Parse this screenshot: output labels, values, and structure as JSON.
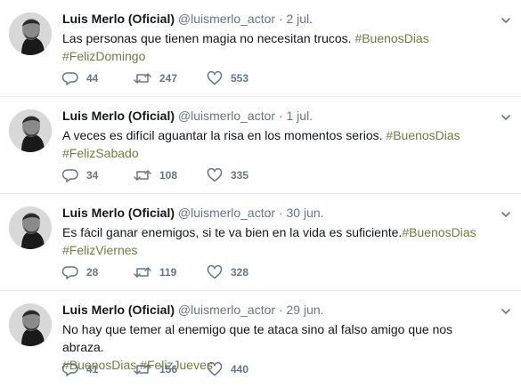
{
  "tweets": [
    {
      "name": "Luis Merlo (Oficial)",
      "handle": "@luismerlo_actor",
      "sep": "·",
      "date": "2 jul.",
      "text": "Las personas que tienen magia no necesitan trucos. ",
      "hashtag1": "#BuenosDias",
      "hashtag2": "#FelizDomingo",
      "replies": "44",
      "retweets": "247",
      "likes": "553"
    },
    {
      "name": "Luis Merlo (Oficial)",
      "handle": "@luismerlo_actor",
      "sep": "·",
      "date": "1 jul.",
      "text": "A veces es difícil aguantar la risa en los momentos serios. ",
      "hashtag1": "#BuenosDias",
      "hashtag2": "#FelizSabado",
      "replies": "34",
      "retweets": "108",
      "likes": "335"
    },
    {
      "name": "Luis Merlo (Oficial)",
      "handle": "@luismerlo_actor",
      "sep": "·",
      "date": "30 jun.",
      "text": "Es fácil ganar enemigos, si te va bien en la vida es suficiente.",
      "hashtag1": "#BuenosDias",
      "hashtag2": "#FelizViernes",
      "replies": "28",
      "retweets": "119",
      "likes": "328"
    },
    {
      "name": "Luis Merlo (Oficial)",
      "handle": "@luismerlo_actor",
      "sep": "·",
      "date": "29 jun.",
      "text": "No hay que temer al enemigo que te ataca sino al falso amigo que nos abraza.",
      "hashtag1": "#BuenosDias",
      "hashtag2": "#FelizJueves",
      "replies": "41",
      "retweets": "156",
      "likes": "440"
    }
  ],
  "icons": {
    "reply": "reply-icon",
    "retweet": "retweet-icon",
    "like": "heart-icon",
    "caret": "chevron-down-icon"
  },
  "colors": {
    "hashtag": "#6b7f3f",
    "muted": "#657786",
    "border": "#e6ecf0"
  }
}
